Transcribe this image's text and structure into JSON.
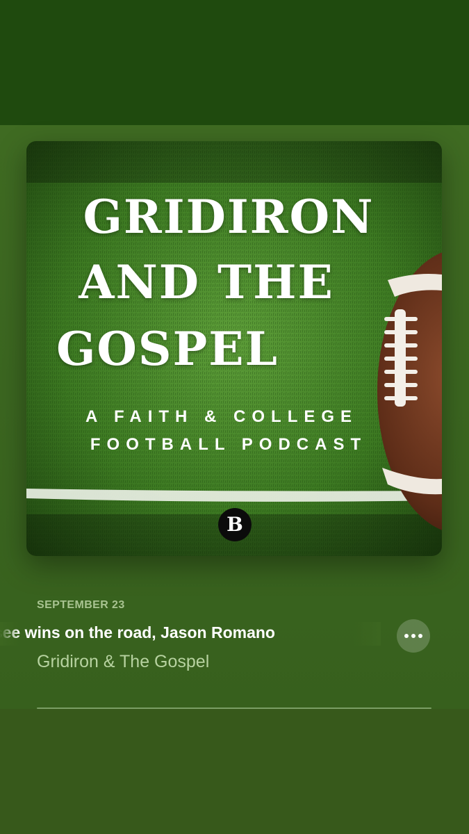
{
  "artwork": {
    "title_lines": [
      "GRIDIRON",
      "AND THE",
      "GOSPEL"
    ],
    "subtitle_lines": [
      "A FAITH & COLLEGE",
      "FOOTBALL PODCAST"
    ],
    "badge_letter": "B"
  },
  "episode": {
    "date": "SEPTEMBER 23",
    "title": "Tennessee wins on the road, Jason Romano",
    "show": "Gridiron & The Gospel"
  },
  "controls": {
    "more_icon": "ellipsis-icon"
  },
  "colors": {
    "background": "#3b6620",
    "top_band": "#1f4a0e",
    "date_text": "#a8c391",
    "show_text": "#b7d2a0"
  }
}
